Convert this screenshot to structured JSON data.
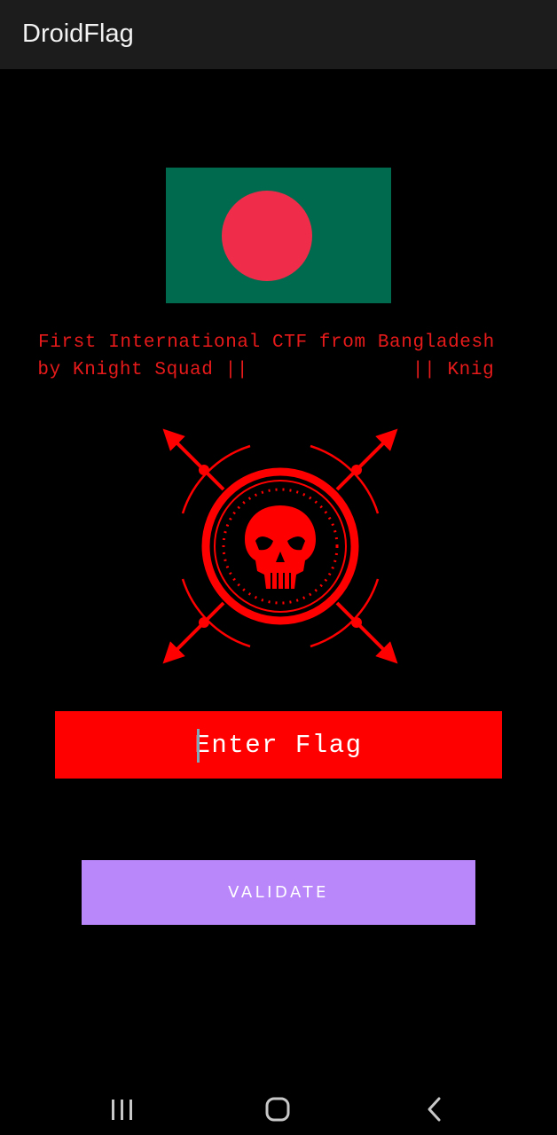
{
  "app_bar": {
    "title": "DroidFlag"
  },
  "flag_image": {
    "icon": "bangladesh-flag",
    "field_color": "#006a4e",
    "disc_color": "#f42a41"
  },
  "marquee": {
    "line1": "First International CTF from Bangladesh",
    "line2": "d by Knight Squad ||              || Knig",
    "color": "#e61a1a"
  },
  "logo": {
    "icon": "skull-crosshair-emblem",
    "color": "#ff0000"
  },
  "flag_input": {
    "value": "",
    "placeholder": "Enter Flag",
    "background": "#ff0000"
  },
  "validate_button": {
    "label": "VALIDATE",
    "background": "#b987fa"
  },
  "navigation_bar": {
    "buttons": [
      {
        "icon": "recent-apps-icon"
      },
      {
        "icon": "home-icon"
      },
      {
        "icon": "back-icon"
      }
    ]
  }
}
